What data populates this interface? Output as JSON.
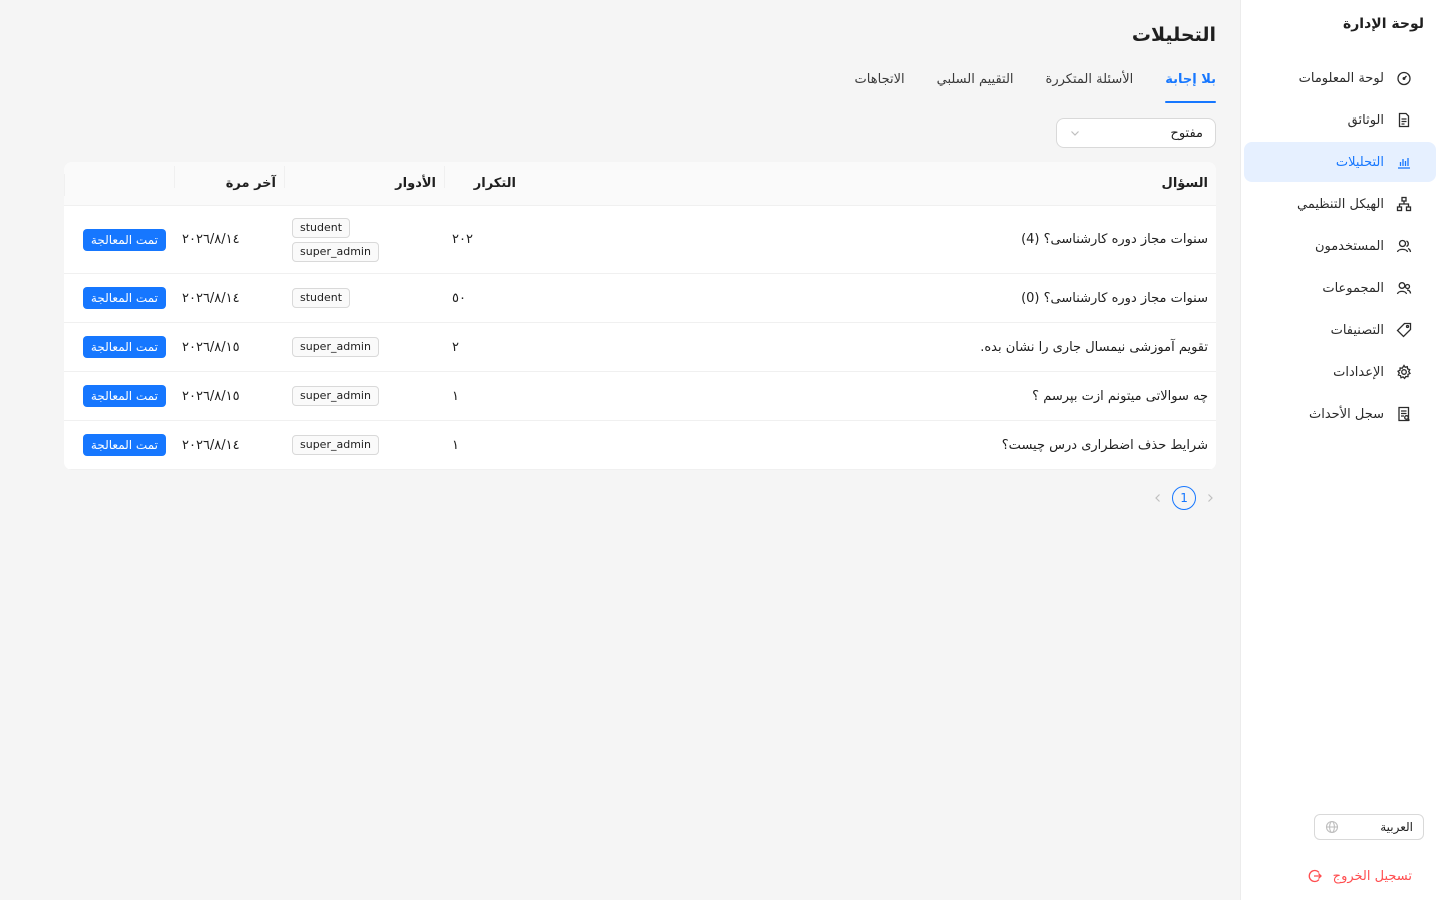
{
  "sidebar": {
    "brand": "لوحة الإدارة",
    "items": [
      {
        "label": "لوحة المعلومات",
        "icon": "dashboard-icon"
      },
      {
        "label": "الوثائق",
        "icon": "document-icon"
      },
      {
        "label": "التحليلات",
        "icon": "bar-chart-icon",
        "active": true
      },
      {
        "label": "الهيكل التنظيمي",
        "icon": "org-chart-icon"
      },
      {
        "label": "المستخدمون",
        "icon": "users-icon"
      },
      {
        "label": "المجموعات",
        "icon": "groups-icon"
      },
      {
        "label": "التصنيفات",
        "icon": "tag-icon"
      },
      {
        "label": "الإعدادات",
        "icon": "settings-icon"
      },
      {
        "label": "سجل الأحداث",
        "icon": "audit-log-icon"
      }
    ],
    "language": "العربية",
    "logout": "تسجيل الخروج"
  },
  "page": {
    "title": "التحليلات",
    "tabs": [
      {
        "label": "بلا إجابة",
        "active": true
      },
      {
        "label": "الأسئلة المتكررة"
      },
      {
        "label": "التقييم السلبي"
      },
      {
        "label": "الاتجاهات"
      }
    ],
    "filter": {
      "value": "مفتوح"
    }
  },
  "table": {
    "columns": {
      "question": "السؤال",
      "frequency": "التكرار",
      "roles": "الأدوار",
      "last_time": "آخر مرة"
    },
    "rows": [
      {
        "question": "سنوات مجاز دوره كارشناسی؟ (4)",
        "frequency": "٢٠٢",
        "roles": [
          "student",
          "super_admin"
        ],
        "date": "٢٠٢٦/٨/١٤",
        "action": "تمت المعالجة"
      },
      {
        "question": "سنوات مجاز دوره كارشناسی؟ (0)",
        "frequency": "٥٠",
        "roles": [
          "student"
        ],
        "date": "٢٠٢٦/٨/١٤",
        "action": "تمت المعالجة"
      },
      {
        "question": "تقويم آموزشی نیمسال جاری را نشان بده.",
        "frequency": "٢",
        "roles": [
          "super_admin"
        ],
        "date": "٢٠٢٦/٨/١٥",
        "action": "تمت المعالجة"
      },
      {
        "question": "چه سوالاتی میتونم ازت بپرسم ؟",
        "frequency": "١",
        "roles": [
          "super_admin"
        ],
        "date": "٢٠٢٦/٨/١٥",
        "action": "تمت المعالجة"
      },
      {
        "question": "شرایط حذف اضطراری درس چیست؟",
        "frequency": "١",
        "roles": [
          "super_admin"
        ],
        "date": "٢٠٢٦/٨/١٤",
        "action": "تمت المعالجة"
      }
    ]
  },
  "pagination": {
    "current": "1"
  },
  "colors": {
    "accent": "#1677ff",
    "active_bg": "#e6f0ff",
    "danger": "#ff4d4f",
    "background": "#f5f5f5"
  }
}
